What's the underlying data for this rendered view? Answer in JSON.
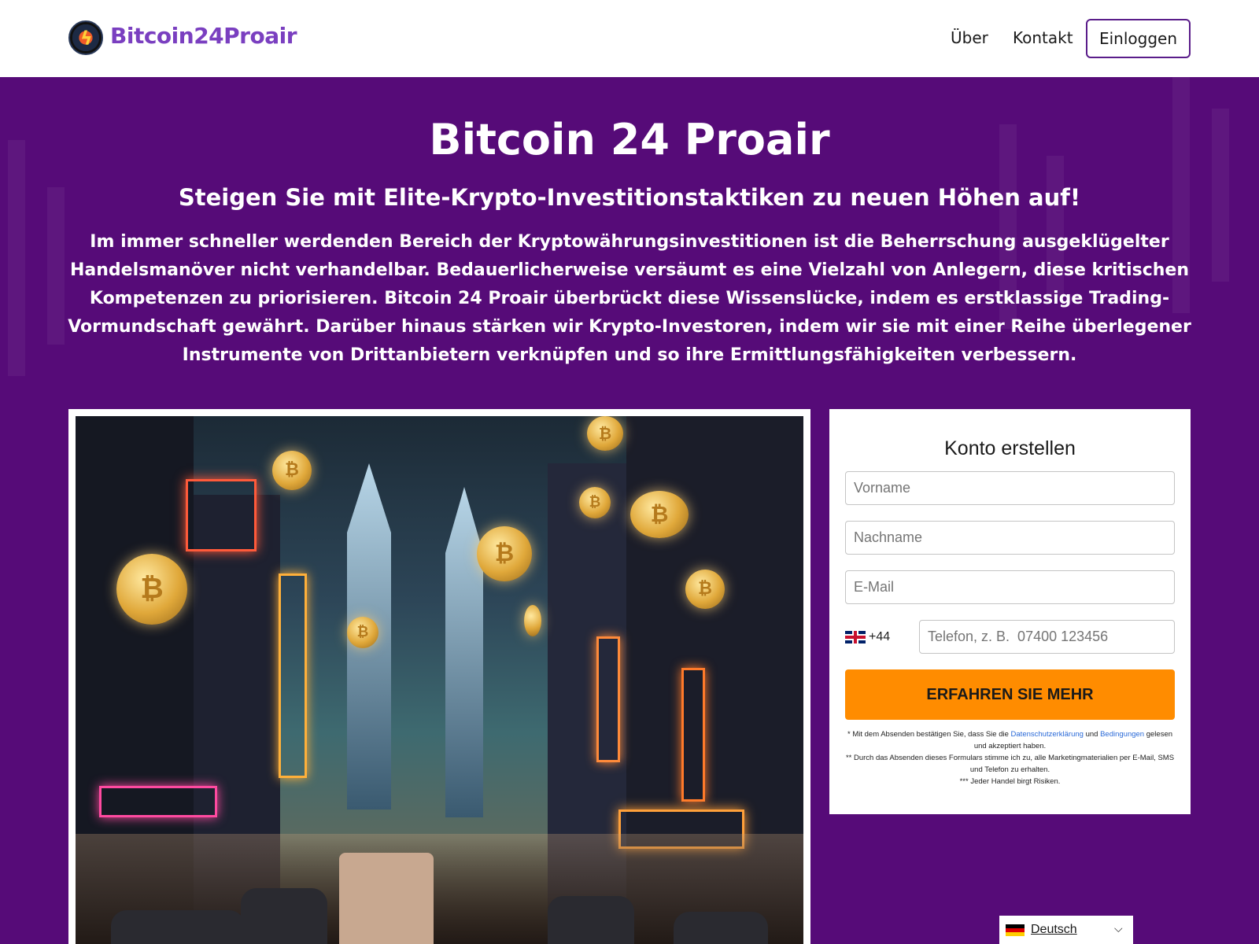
{
  "header": {
    "brand": "Bitcoin24Proair",
    "nav": {
      "about": "Über",
      "contact": "Kontakt",
      "login": "Einloggen"
    },
    "logo_icon": "bitcoin-lightning-logo"
  },
  "hero": {
    "title": "Bitcoin 24 Proair",
    "subtitle": "Steigen Sie mit Elite-Krypto-Investitionstaktiken zu neuen Höhen auf!",
    "body": "Im immer schneller werdenden Bereich der Kryptowährungsinvestitionen ist die Beherrschung ausgeklügelter Handelsmanöver nicht verhandelbar. Bedauerlicherweise versäumt es eine Vielzahl von Anlegern, diese kritischen Kompetenzen zu priorisieren. Bitcoin 24 Proair überbrückt diese Wissenslücke, indem es erstklassige Trading-Vormundschaft gewährt. Darüber hinaus stärken wir Krypto-Investoren, indem wir sie mit einer Reihe überlegener Instrumente von Drittanbietern verknüpfen und so ihre Ermittlungsfähigkeiten verbessern."
  },
  "form": {
    "title": "Konto erstellen",
    "first_name_placeholder": "Vorname",
    "last_name_placeholder": "Nachname",
    "email_placeholder": "E-Mail",
    "phone_code": "+44",
    "phone_placeholder": "Telefon, z. B.  07400 123456",
    "submit_label": "ERFAHREN SIE MEHR",
    "disclaimer": {
      "line1_prefix": "* Mit dem Absenden bestätigen Sie, dass Sie die ",
      "privacy_link": "Datenschutzerklärung",
      "line1_mid": " und ",
      "terms_link": "Bedingungen",
      "line1_suffix": " gelesen und akzeptiert haben.",
      "line2": "** Durch das Absenden dieses Formulars stimme ich zu, alle Marketingmaterialien per E-Mail, SMS und Telefon zu erhalten.",
      "line3": "*** Jeder Handel birgt Risiken."
    }
  },
  "language": {
    "label": "Deutsch"
  },
  "colors": {
    "hero_bg": "#560b78",
    "brand": "#7a3fc0",
    "cta": "#ff8c00",
    "link": "#2a6ad8"
  }
}
